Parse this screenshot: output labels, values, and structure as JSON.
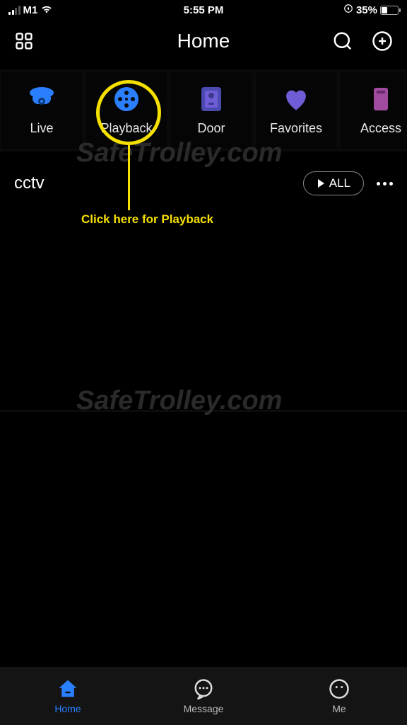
{
  "status_bar": {
    "carrier": "M1",
    "time": "5:55 PM",
    "battery_pct": "35%"
  },
  "top_nav": {
    "title": "Home"
  },
  "categories": [
    {
      "label": "Live",
      "icon": "camera"
    },
    {
      "label": "Playback",
      "icon": "reel"
    },
    {
      "label": "Door",
      "icon": "door"
    },
    {
      "label": "Favorites",
      "icon": "heart"
    },
    {
      "label": "Access",
      "icon": "access"
    }
  ],
  "device": {
    "name": "cctv",
    "all_label": "ALL"
  },
  "annotation": {
    "text": "Click here for Playback"
  },
  "watermark": "SafeTrolley.com",
  "bottom_nav": [
    {
      "label": "Home",
      "active": true
    },
    {
      "label": "Message",
      "active": false
    },
    {
      "label": "Me",
      "active": false
    }
  ],
  "colors": {
    "accent_blue": "#2a7fff",
    "purple": "#6e5dd6",
    "annotation": "#f5e000"
  }
}
